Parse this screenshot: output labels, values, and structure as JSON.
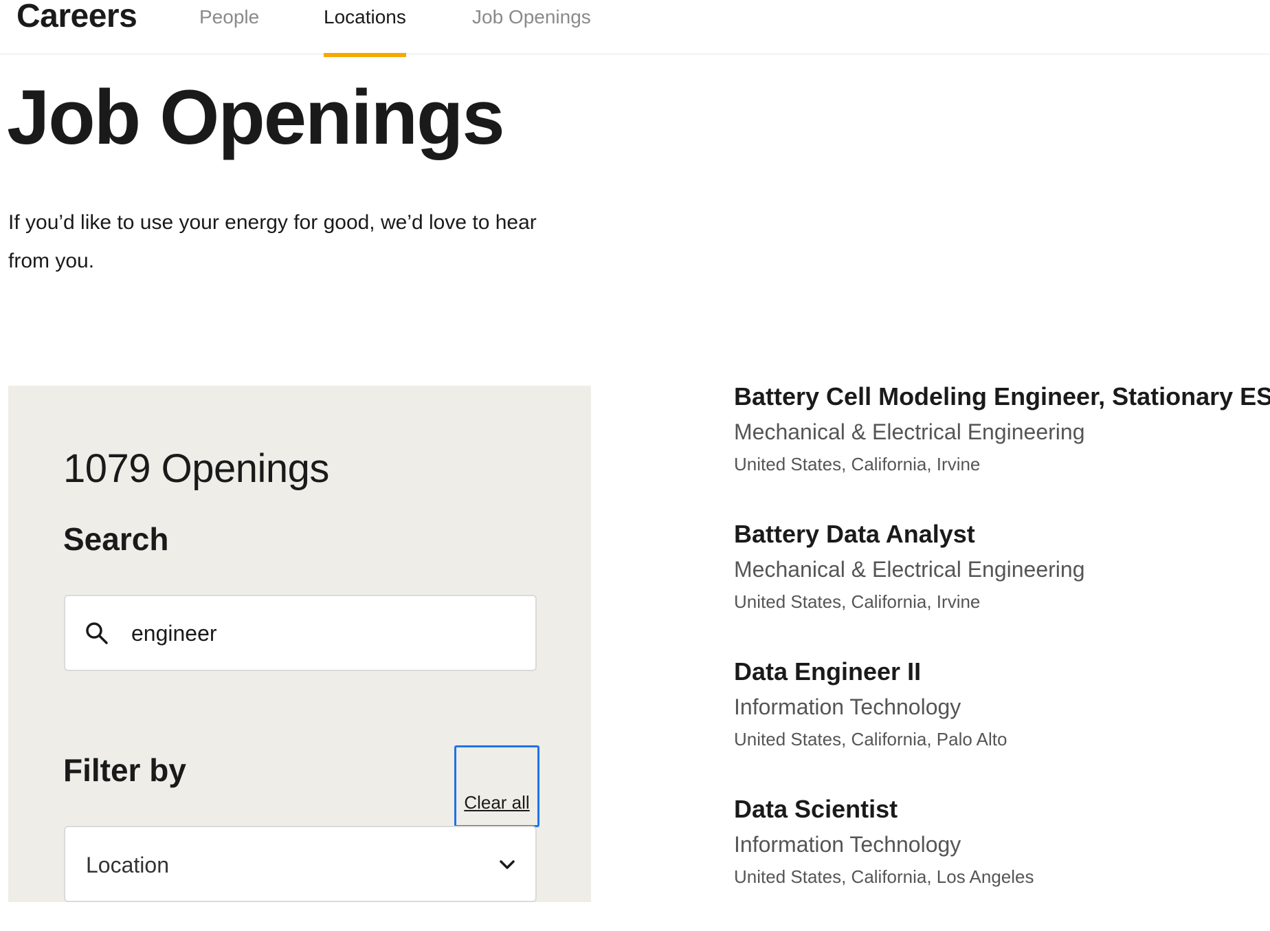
{
  "nav": {
    "brand": "Careers",
    "tabs": [
      {
        "label": "People",
        "active": false
      },
      {
        "label": "Locations",
        "active": true
      },
      {
        "label": "Job Openings",
        "active": false
      }
    ],
    "accent_color": "#f5a800"
  },
  "hero": {
    "title": "Job Openings",
    "intro": "If you’d like to use your energy for good, we’d love to hear from you."
  },
  "filters": {
    "openings_count": "1079 Openings",
    "search_heading": "Search",
    "search_value": "engineer",
    "search_icon": "search-icon",
    "filter_heading": "Filter by",
    "clear_all_label": "Clear all",
    "location_select": {
      "selected": "Location",
      "icon": "chevron-down-icon"
    },
    "panel_color": "#eeede8",
    "focus_color": "#1f73e8"
  },
  "jobs": [
    {
      "title": "Battery Cell Modeling Engineer, Stationary ESS",
      "department": "Mechanical & Electrical Engineering",
      "location": "United States, California, Irvine"
    },
    {
      "title": "Battery Data Analyst",
      "department": "Mechanical & Electrical Engineering",
      "location": "United States, California, Irvine"
    },
    {
      "title": "Data Engineer II",
      "department": "Information Technology",
      "location": "United States, California, Palo Alto"
    },
    {
      "title": "Data Scientist",
      "department": "Information Technology",
      "location": "United States, California, Los Angeles"
    }
  ]
}
